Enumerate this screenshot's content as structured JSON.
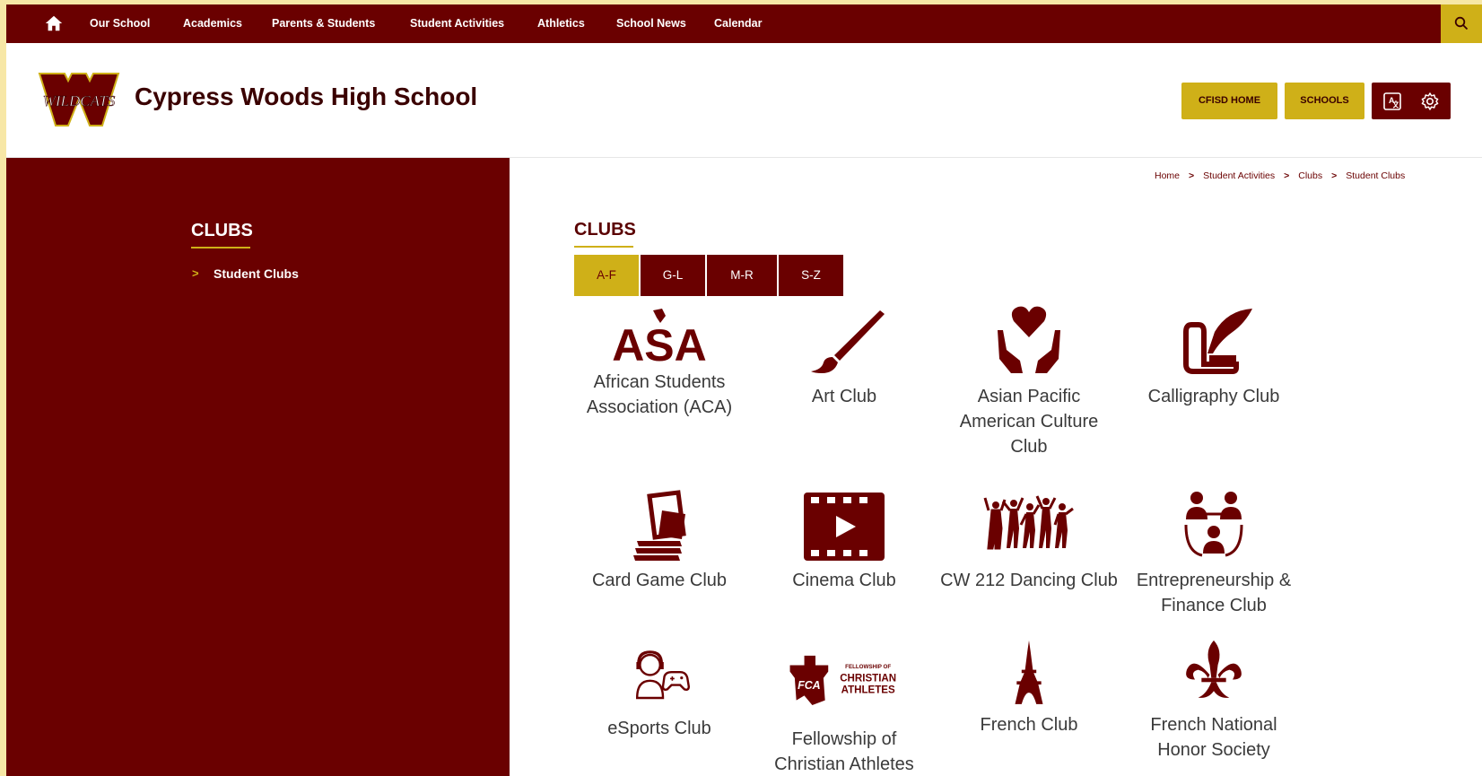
{
  "topnav": {
    "items": [
      "Our School",
      "Academics",
      "Parents & Students",
      "Student Activities",
      "Athletics",
      "School News",
      "Calendar"
    ]
  },
  "header": {
    "logo_text": "WILDCATS",
    "school_name": "Cypress Woods High School",
    "buttons": [
      "CFISD HOME",
      "SCHOOLS"
    ]
  },
  "sidebar": {
    "title": "CLUBS",
    "items": [
      {
        "chevron": ">",
        "label": "Student Clubs"
      }
    ]
  },
  "breadcrumb": {
    "items": [
      "Home",
      "Student Activities",
      "Clubs",
      "Student Clubs"
    ],
    "separator": ">"
  },
  "main": {
    "title": "CLUBS",
    "tabs": [
      {
        "label": "A-F",
        "active": true
      },
      {
        "label": "G-L",
        "active": false
      },
      {
        "label": "M-R",
        "active": false
      },
      {
        "label": "S-Z",
        "active": false
      }
    ],
    "clubs": [
      {
        "label": "African Students Association (ACA)",
        "icon": "asa-logo-icon",
        "icon_text": "ASA"
      },
      {
        "label": "Art Club",
        "icon": "paintbrush-icon"
      },
      {
        "label": "Asian Pacific American Culture Club",
        "icon": "heart-hands-icon"
      },
      {
        "label": "Calligraphy Club",
        "icon": "quill-scroll-icon"
      },
      {
        "label": "Card Game Club",
        "icon": "cards-icon"
      },
      {
        "label": "Cinema Club",
        "icon": "film-play-icon"
      },
      {
        "label": "CW 212 Dancing Club",
        "icon": "dancers-icon"
      },
      {
        "label": "Entrepreneurship & Finance Club",
        "icon": "network-people-icon"
      },
      {
        "label": "eSports Club",
        "icon": "gamer-icon"
      },
      {
        "label": "Fellowship of Christian Athletes",
        "icon": "fca-logo-icon",
        "icon_text": [
          "FELLOWSHIP OF",
          "CHRISTIAN",
          "ATHLETES",
          "FCA"
        ]
      },
      {
        "label": "French Club",
        "icon": "eiffel-tower-icon"
      },
      {
        "label": "French National Honor Society",
        "icon": "fleur-de-lis-icon"
      }
    ]
  },
  "colors": {
    "maroon": "#6a0000",
    "gold": "#cfb018",
    "frame": "#f7e7a6"
  }
}
